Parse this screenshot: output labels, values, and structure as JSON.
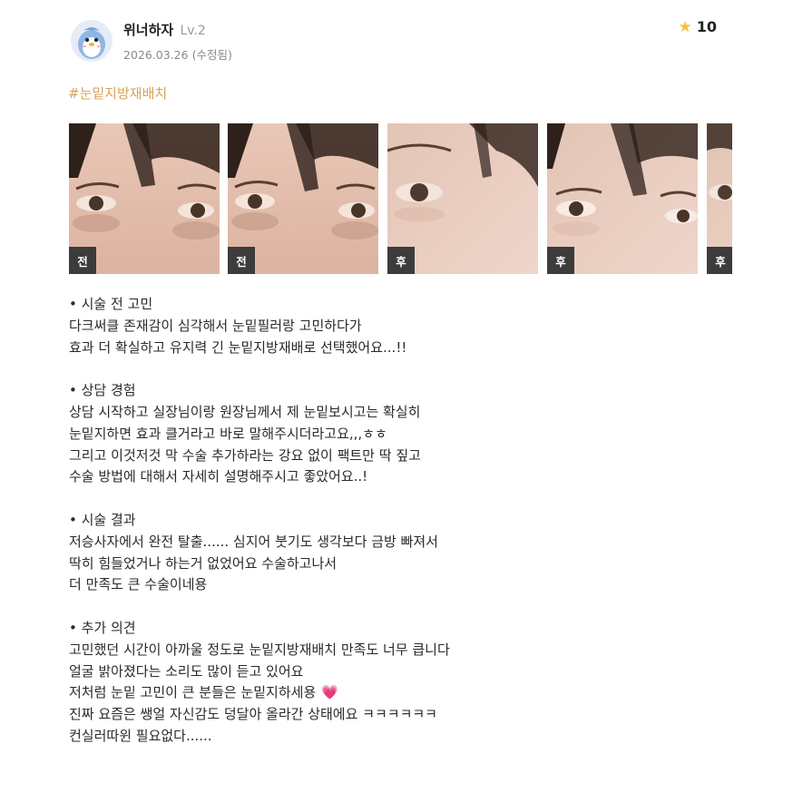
{
  "review": {
    "author": "위너하자",
    "level": "Lv.2",
    "date": "2026.03.26",
    "edited": "(수정됨)",
    "rating_icon": "star-icon",
    "rating": "10",
    "tag": "#눈밑지방재배치"
  },
  "gallery": {
    "photos": [
      {
        "label": "전",
        "icon": "face-photo"
      },
      {
        "label": "전",
        "icon": "face-photo"
      },
      {
        "label": "후",
        "icon": "face-photo"
      },
      {
        "label": "후",
        "icon": "face-photo"
      },
      {
        "label": "후",
        "icon": "face-photo"
      }
    ]
  },
  "body": {
    "s1": {
      "heading": "• 시술 전 고민",
      "lines": [
        "다크써클 존재감이 심각해서 눈밑필러랑 고민하다가",
        "효과 더 확실하고 유지력 긴 눈밑지방재배로 선택했어요...!!"
      ]
    },
    "s2": {
      "heading": "• 상담 경험",
      "lines": [
        "상담 시작하고 실장님이랑 원장님께서 제 눈밑보시고는 확실히",
        "눈밑지하면 효과 클거라고 바로 말해주시더라고요,,,ㅎㅎ",
        "그리고 이것저것 막 수술 추가하라는 강요 없이 팩트만 딱 짚고",
        "수술 방법에 대해서 자세히 설명해주시고 좋았어요..!"
      ]
    },
    "s3": {
      "heading": "• 시술 결과",
      "lines": [
        "저승사자에서 완전 탈출...... 심지어 붓기도 생각보다 금방 빠져서",
        "딱히 힘들었거나 하는거 없었어요 수술하고나서",
        "더 만족도 큰 수술이네용"
      ]
    },
    "s4": {
      "heading": "• 추가 의견",
      "lines": [
        "고민했던 시간이 아까울 정도로 눈밑지방재배치 만족도 너무 큽니다",
        "얼굴 밝아졌다는 소리도 많이 듣고 있어요",
        "저처럼 눈밑 고민이 큰 분들은 눈밑지하세용",
        "진짜 요즘은 쌩얼 자신감도 덩달아 올라간 상태에요 ㅋㅋㅋㅋㅋㅋ",
        "컨실러따윈 필요없다......"
      ],
      "heart": "💗"
    }
  },
  "colors": {
    "tag": "#d8a35a",
    "label_bg": "#3c3c3c",
    "star": "#f5c342",
    "heart": "#f06aa8"
  }
}
